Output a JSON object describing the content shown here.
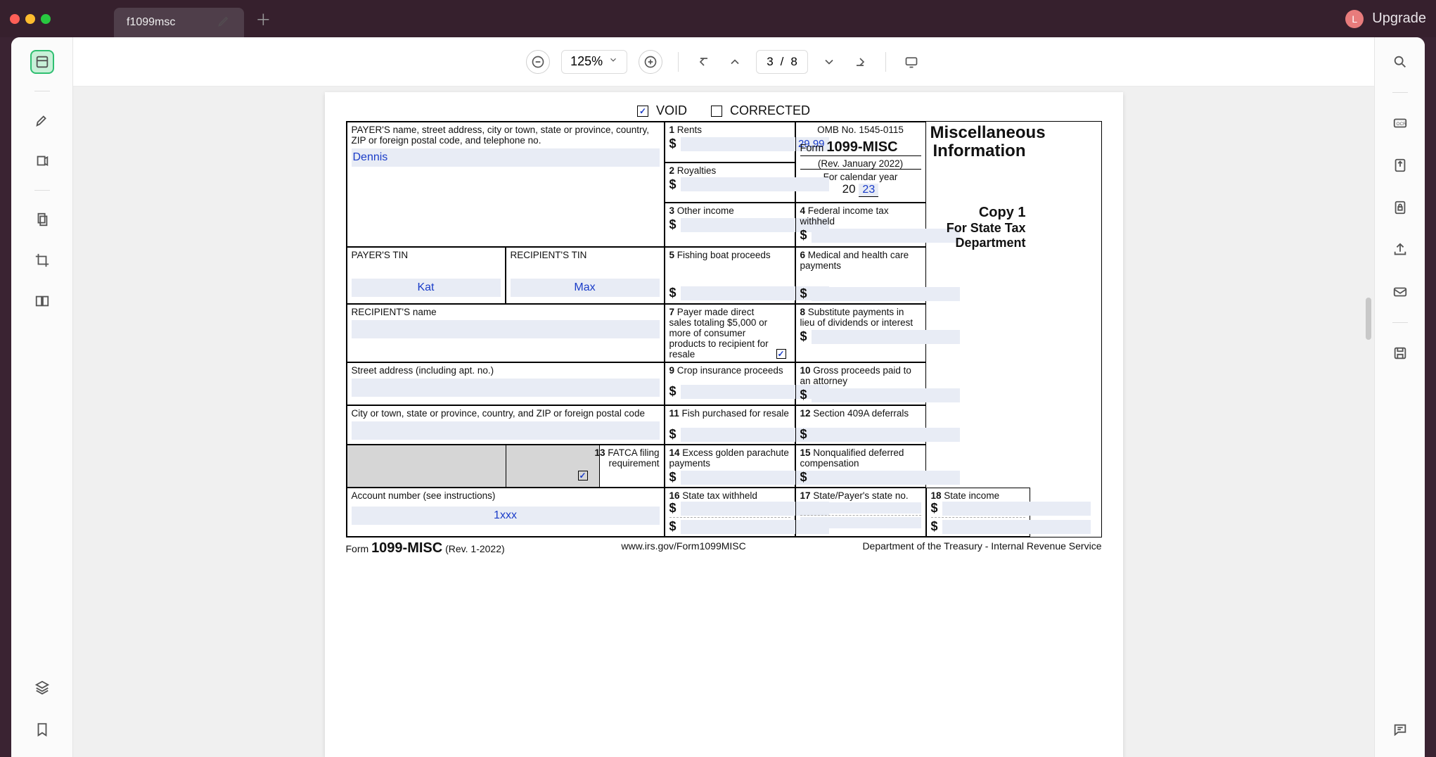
{
  "titlebar": {
    "tab_title": "f1099msc",
    "avatar_letter": "L",
    "upgrade_label": "Upgrade"
  },
  "toolbar": {
    "zoom": "125%",
    "page_current": "3",
    "page_sep": "/",
    "page_total": "8"
  },
  "form": {
    "checks": {
      "void_label": "VOID",
      "void_checked": true,
      "corrected_label": "CORRECTED",
      "corrected_checked": false
    },
    "payer_block_label": "PAYER'S name, street address, city or town, state or province, country, ZIP or foreign postal code, and telephone no.",
    "payer_name_value": "Dennis",
    "box1_label": "1 Rents",
    "box1_amount": "29.99",
    "box2_label": "2 Royalties",
    "box3_label": "3 Other income",
    "box4_label": "4 Federal income tax withheld",
    "omb": "OMB No. 1545-0115",
    "form_word": "Form",
    "form_name": "1099-MISC",
    "rev": "(Rev. January 2022)",
    "cal_label": "For calendar year",
    "cal_prefix": "20",
    "cal_year": "23",
    "right_title_1": "Miscellaneous",
    "right_title_2": "Information",
    "copy_label": "Copy 1",
    "copy_sub1": "For State Tax",
    "copy_sub2": "Department",
    "payer_tin_label": "PAYER'S TIN",
    "payer_tin_value": "Kat",
    "recipient_tin_label": "RECIPIENT'S TIN",
    "recipient_tin_value": "Max",
    "box5_label": "5 Fishing boat proceeds",
    "box6_label": "6 Medical and health care payments",
    "recipient_name_label": "RECIPIENT'S name",
    "box7_label": "7 Payer made direct sales totaling $5,000 or more of consumer products to recipient for resale",
    "box7_checked": true,
    "box8_label": "8 Substitute payments in lieu of dividends or interest",
    "street_label": "Street address (including apt. no.)",
    "box9_label": "9 Crop insurance proceeds",
    "box10_label": "10 Gross proceeds paid to an attorney",
    "city_label": "City or town, state or province, country, and ZIP or foreign postal code",
    "box11_label": "11 Fish purchased for resale",
    "box12_label": "12 Section 409A deferrals",
    "box13_label": "13 FATCA filing requirement",
    "box13_checked": true,
    "box14_label": "14 Excess golden parachute payments",
    "box15_label": "15 Nonqualified deferred compensation",
    "account_label": "Account number (see instructions)",
    "account_value": "1xxx",
    "box16_label": "16 State tax withheld",
    "box17_label": "17 State/Payer's state no.",
    "box18_label": "18 State income",
    "footer_form_word": "Form",
    "footer_form_name": "1099-MISC",
    "footer_rev": "(Rev. 1-2022)",
    "footer_url": "www.irs.gov/Form1099MISC",
    "footer_dept": "Department of the Treasury - Internal Revenue Service"
  }
}
